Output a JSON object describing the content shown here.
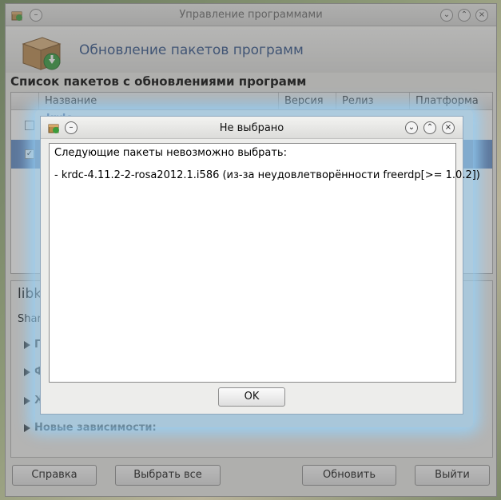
{
  "main_window": {
    "title": "Управление программами",
    "header_title": "Обновление пакетов программ",
    "list_title": "Список пакетов с обновлениями программ",
    "columns": [
      "Название",
      "Версия",
      "Релиз",
      "Платформа"
    ],
    "rows": [
      {
        "name": "krdc",
        "checked": false
      },
      {
        "name": "",
        "checked": true
      }
    ],
    "details": {
      "name": "libk",
      "sub": "Share",
      "items": [
        "П",
        "Ф",
        "Ж",
        "Новые зависимости:"
      ]
    },
    "buttons": {
      "help": "Справка",
      "select_all": "Выбрать все",
      "update": "Обновить",
      "exit": "Выйти"
    }
  },
  "dialog": {
    "title": "Не выбрано",
    "line1": "Следующие пакеты невозможно выбрать:",
    "line2": "- krdc-4.11.2-2-rosa2012.1.i586 (из-за неудовлетворённости freerdp[>= 1.0.2])",
    "ok_label": "OK"
  },
  "icons": {
    "app": "package-box-icon",
    "update": "download-arrow-icon"
  },
  "colors": {
    "accent_blue": "#2c4f86",
    "selection": "#5b87c4",
    "glow": "#96d2fa"
  }
}
